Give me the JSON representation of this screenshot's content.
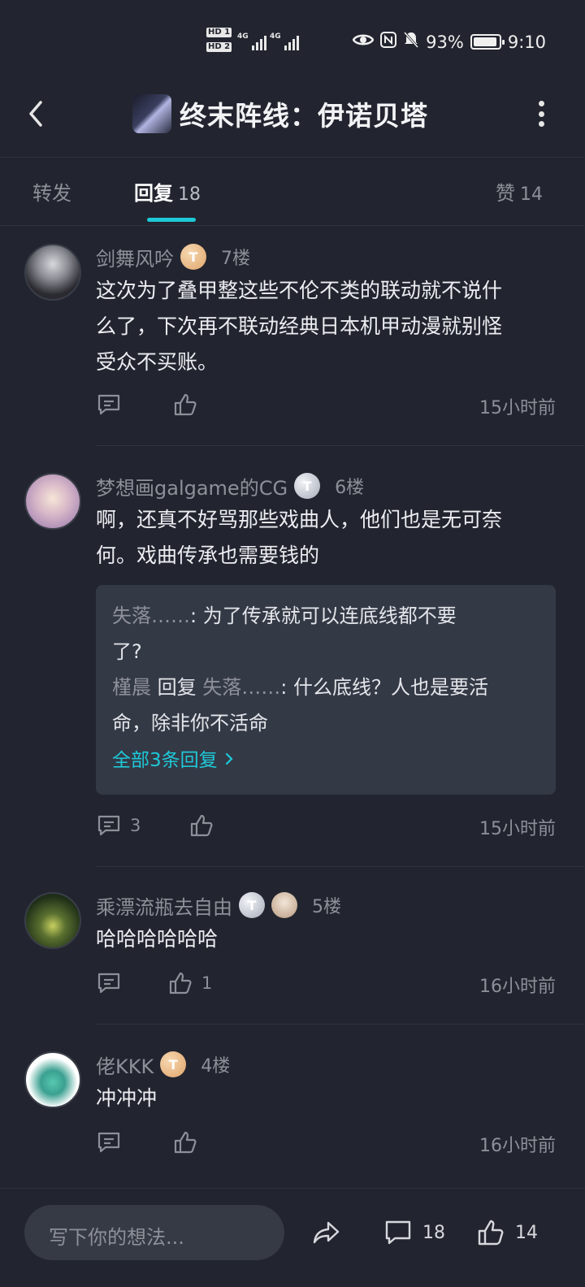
{
  "status_bar": {
    "hd1": "HD 1",
    "hd2": "HD 2",
    "net1": "4G",
    "net2": "4G",
    "battery_pct": "93%",
    "battery_level": 0.93,
    "time": "9:10"
  },
  "header": {
    "title": "终末阵线：伊诺贝塔"
  },
  "tabs": [
    {
      "label": "转发",
      "count": ""
    },
    {
      "label": "回复",
      "count": "18"
    },
    {
      "label": "赞",
      "count": "14"
    }
  ],
  "comments": [
    {
      "user": "剑舞风吟",
      "badge_letter": "T",
      "floor": "7楼",
      "text_lines": [
        "这次为了叠甲整这些不伦不类的联动就不说什",
        "么了，下次再不联动经典日本机甲动漫就别怪",
        "受众不买账。"
      ],
      "reply_count": "",
      "like_count": "",
      "time": "15小时前"
    },
    {
      "user": "梦想画galgame的CG",
      "badge_letter": "T",
      "floor": "6楼",
      "text_lines": [
        "啊，还真不好骂那些戏曲人，他们也是无可奈",
        "何。戏曲传承也需要钱的"
      ],
      "replies": {
        "r1_user": "失落……",
        "r1_text_1": ": 为了传承就可以连底线都不要",
        "r1_text_2": "了?",
        "r2_user": "槿晨",
        "r2_reply_word": "回复",
        "r2_target": "失落……",
        "r2_text_1": ": 什么底线？人也是要活",
        "r2_text_2": "命，除非你不活命",
        "more": "全部3条回复"
      },
      "reply_count": "3",
      "like_count": "",
      "time": "15小时前"
    },
    {
      "user": "乘漂流瓶去自由",
      "badge_letter": "T",
      "floor": "5楼",
      "text_lines": [
        "哈哈哈哈哈哈"
      ],
      "reply_count": "",
      "like_count": "1",
      "time": "16小时前"
    },
    {
      "user": "佬KKK",
      "badge_letter": "T",
      "floor": "4楼",
      "text_lines": [
        "冲冲冲"
      ],
      "reply_count": "",
      "like_count": "",
      "time": "16小时前"
    }
  ],
  "bottom_bar": {
    "input_placeholder": "写下你的想法...",
    "comment_count": "18",
    "like_count": "14"
  },
  "colors": {
    "background": "#22252f",
    "accent": "#1ec8d7",
    "muted_text": "#8d9099",
    "reply_box": "#343946"
  }
}
